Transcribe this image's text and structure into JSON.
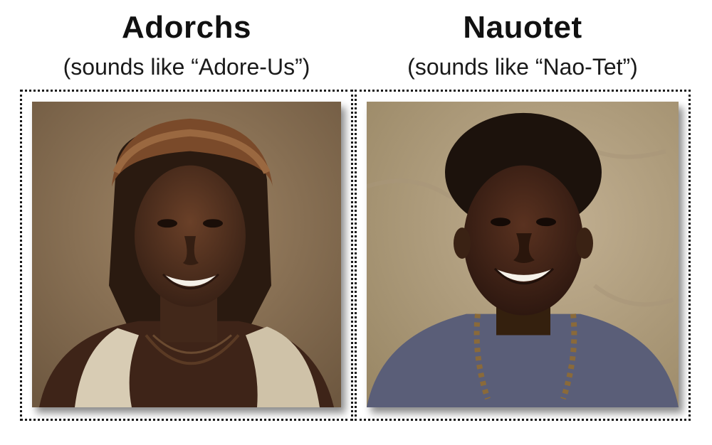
{
  "profiles": [
    {
      "name": "Adorchs",
      "pronunciation": "(sounds like “Adore-Us”)"
    },
    {
      "name": "Nauotet",
      "pronunciation": "(sounds like “Nao-Tet”)"
    }
  ],
  "colors": {
    "frame_border": "#1a1a1a",
    "left_background": "#8a7256",
    "right_background": "#b4a286",
    "skin": "#4a2c1c",
    "left_garment": "#d8ccb4",
    "right_shirt": "#5a5e78"
  }
}
